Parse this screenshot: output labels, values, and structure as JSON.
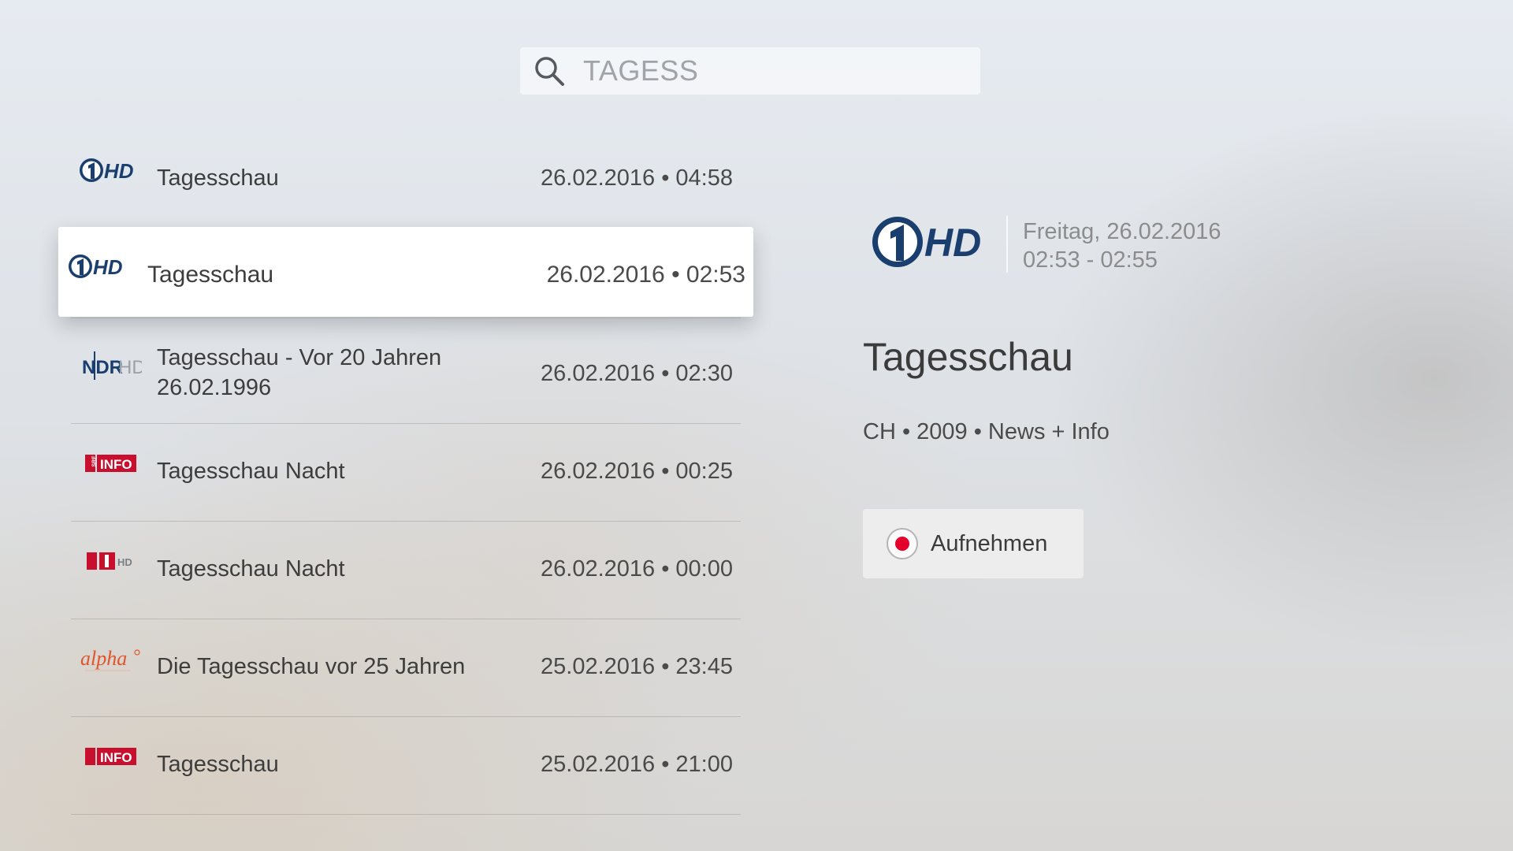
{
  "search": {
    "query": "TAGESS",
    "icon": "search-icon"
  },
  "results": [
    {
      "channel": "Das Erste HD",
      "title": "Tagesschau",
      "subtitle": "",
      "date": "26.02.2016 • 04:58",
      "logo": "daserste-hd"
    },
    {
      "channel": "Das Erste HD",
      "title": "Tagesschau",
      "subtitle": "",
      "date": "26.02.2016 • 02:53",
      "logo": "daserste-hd",
      "selected": true
    },
    {
      "channel": "NDR HD",
      "title": "Tagesschau - Vor 20 Jahren",
      "subtitle": "26.02.1996",
      "date": "26.02.2016 • 02:30",
      "logo": "ndr-hd"
    },
    {
      "channel": "SRF info",
      "title": "Tagesschau Nacht",
      "subtitle": "",
      "date": "26.02.2016 • 00:25",
      "logo": "srf-info"
    },
    {
      "channel": "SRF 1 HD",
      "title": "Tagesschau Nacht",
      "subtitle": "",
      "date": "26.02.2016 • 00:00",
      "logo": "srf1-hd"
    },
    {
      "channel": "ARD-alpha",
      "title": "Die Tagesschau vor 25 Jahren",
      "subtitle": "",
      "date": "25.02.2016 • 23:45",
      "logo": "ard-alpha"
    },
    {
      "channel": "SRF info",
      "title": "Tagesschau",
      "subtitle": "",
      "date": "25.02.2016 • 21:00",
      "logo": "srf-info"
    }
  ],
  "detail": {
    "day": "Freitag, 26.02.2016",
    "time": "02:53 - 02:55",
    "title": "Tagesschau",
    "meta": "CH • 2009 • News + Info",
    "record_label": "Aufnehmen"
  },
  "colors": {
    "ard_blue": "#1a3e6e",
    "srf_red": "#c8102e",
    "record_red": "#e4002b",
    "alpha_orange": "#e2542a"
  }
}
